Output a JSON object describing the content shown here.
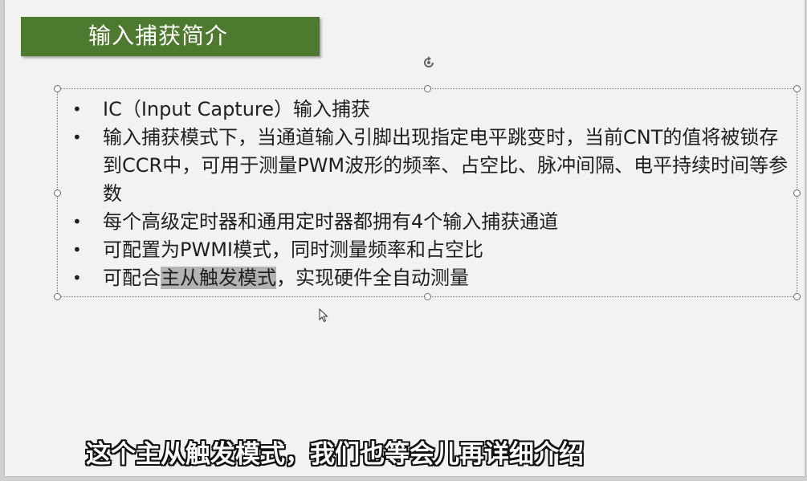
{
  "slide": {
    "title": "输入捕获简介",
    "bullets": [
      {
        "text": "IC（Input Capture）输入捕获"
      },
      {
        "text": "输入捕获模式下，当通道输入引脚出现指定电平跳变时，当前CNT的值将被锁存到CCR中，可用于测量PWM波形的频率、占空比、脉冲间隔、电平持续时间等参数"
      },
      {
        "text": "每个高级定时器和通用定时器都拥有4个输入捕获通道"
      },
      {
        "text": "可配置为PWMI模式，同时测量频率和占空比"
      },
      {
        "before": "可配合",
        "highlight": "主从触发模式",
        "after": "，实现硬件全自动测量"
      }
    ],
    "bullet_glyph": "•"
  },
  "subtitle": "这个主从触发模式，我们也等会儿再详细介绍",
  "colors": {
    "title_banner": "#4e7a2f",
    "title_text": "#ffffff",
    "body_text": "#1f1f1f",
    "highlight": "#b3b3b3",
    "slide_background": "#f2f2f2"
  },
  "icons": {
    "rotate_handle": "rotate-icon",
    "mouse_cursor": "arrow-cursor-icon"
  }
}
